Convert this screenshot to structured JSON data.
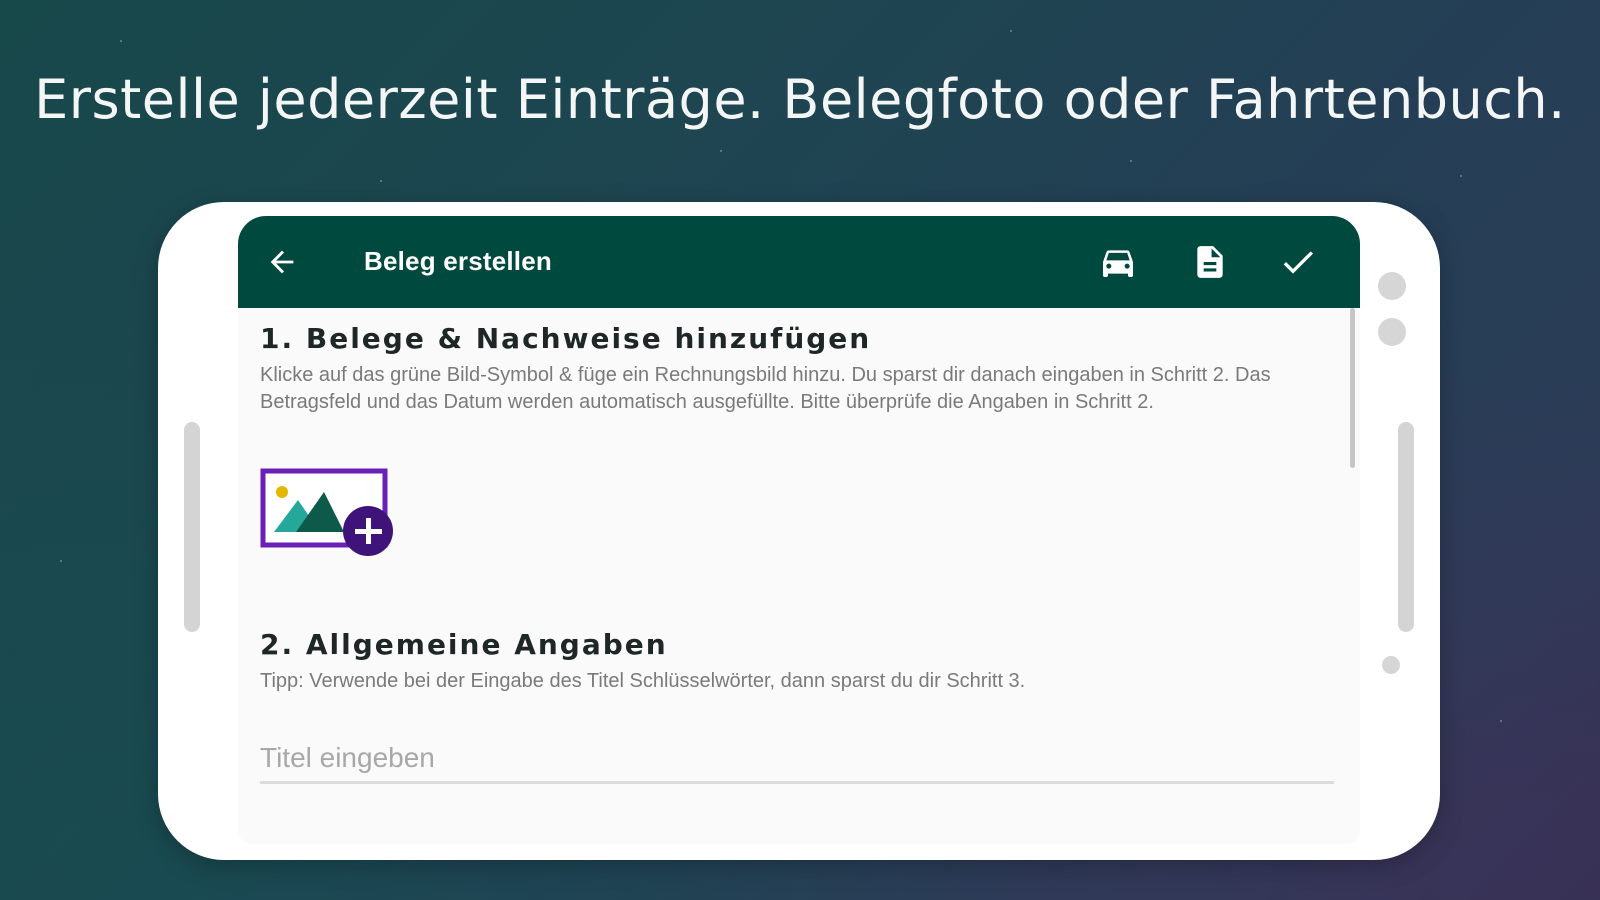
{
  "headline": "Erstelle jederzeit Einträge. Belegfoto oder Fahrtenbuch.",
  "appbar": {
    "title": "Beleg erstellen",
    "back_icon": "arrow-left-icon",
    "actions": [
      "car-icon",
      "document-icon",
      "check-icon"
    ]
  },
  "section1": {
    "title": "1. Belege & Nachweise hinzufügen",
    "text": "Klicke auf das grüne Bild-Symbol & füge ein Rechnungsbild hinzu. Du sparst dir danach eingaben in Schritt 2. Das Betragsfeld und das Datum werden automatisch ausgefüllte. Bitte überprüfe die Angaben in Schritt 2."
  },
  "section2": {
    "title": "2. Allgemeine Angaben",
    "text": "Tipp: Verwende bei der Eingabe des Titel Schlüsselwörter, dann sparst du dir Schritt 3."
  },
  "title_input": {
    "value": "",
    "placeholder": "Titel eingeben"
  },
  "colors": {
    "appbar": "#00493f",
    "image_frame": "#6a1fb8",
    "add_badge": "#3f147a",
    "mountain_teal": "#25a89a",
    "mountain_dark": "#0e5a4a",
    "sun": "#e5b800"
  }
}
